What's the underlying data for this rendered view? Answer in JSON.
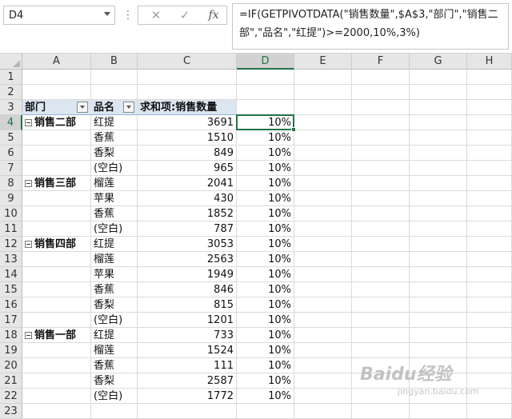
{
  "name_box": "D4",
  "formula_bar": {
    "cancel_icon": "✕",
    "enter_icon": "✓",
    "fx_label": "fx",
    "formula": "=IF(GETPIVOTDATA(\"销售数量\",$A$3,\"部门\",\"销售二部\",\"品名\",\"红提\")>=2000,10%,3%)"
  },
  "columns": [
    "A",
    "B",
    "C",
    "D",
    "E",
    "F",
    "G",
    "H"
  ],
  "rows": [
    "1",
    "2",
    "3",
    "4",
    "5",
    "6",
    "7",
    "8",
    "9",
    "10",
    "11",
    "12",
    "13",
    "14",
    "15",
    "16",
    "17",
    "18",
    "19",
    "20",
    "21",
    "22",
    "23"
  ],
  "pivot": {
    "headers": {
      "dept": "部门",
      "product": "品名",
      "sum": "求和项:销售数量"
    },
    "data": [
      {
        "dept": "销售二部",
        "product": "红提",
        "qty": "3691",
        "rate": "10%"
      },
      {
        "dept": "",
        "product": "香蕉",
        "qty": "1510",
        "rate": "10%"
      },
      {
        "dept": "",
        "product": "香梨",
        "qty": "849",
        "rate": "10%"
      },
      {
        "dept": "",
        "product": "(空白)",
        "qty": "965",
        "rate": "10%"
      },
      {
        "dept": "销售三部",
        "product": "榴莲",
        "qty": "2041",
        "rate": "10%"
      },
      {
        "dept": "",
        "product": "苹果",
        "qty": "430",
        "rate": "10%"
      },
      {
        "dept": "",
        "product": "香蕉",
        "qty": "1852",
        "rate": "10%"
      },
      {
        "dept": "",
        "product": "(空白)",
        "qty": "787",
        "rate": "10%"
      },
      {
        "dept": "销售四部",
        "product": "红提",
        "qty": "3053",
        "rate": "10%"
      },
      {
        "dept": "",
        "product": "榴莲",
        "qty": "2563",
        "rate": "10%"
      },
      {
        "dept": "",
        "product": "苹果",
        "qty": "1949",
        "rate": "10%"
      },
      {
        "dept": "",
        "product": "香蕉",
        "qty": "846",
        "rate": "10%"
      },
      {
        "dept": "",
        "product": "香梨",
        "qty": "815",
        "rate": "10%"
      },
      {
        "dept": "",
        "product": "(空白)",
        "qty": "1201",
        "rate": "10%"
      },
      {
        "dept": "销售一部",
        "product": "红提",
        "qty": "733",
        "rate": "10%"
      },
      {
        "dept": "",
        "product": "榴莲",
        "qty": "1524",
        "rate": "10%"
      },
      {
        "dept": "",
        "product": "香蕉",
        "qty": "111",
        "rate": "10%"
      },
      {
        "dept": "",
        "product": "香梨",
        "qty": "2587",
        "rate": "10%"
      },
      {
        "dept": "",
        "product": "(空白)",
        "qty": "1772",
        "rate": "10%"
      }
    ]
  },
  "watermark": {
    "main": "Baidu经验",
    "sub": "jingyan.baidu.com"
  }
}
